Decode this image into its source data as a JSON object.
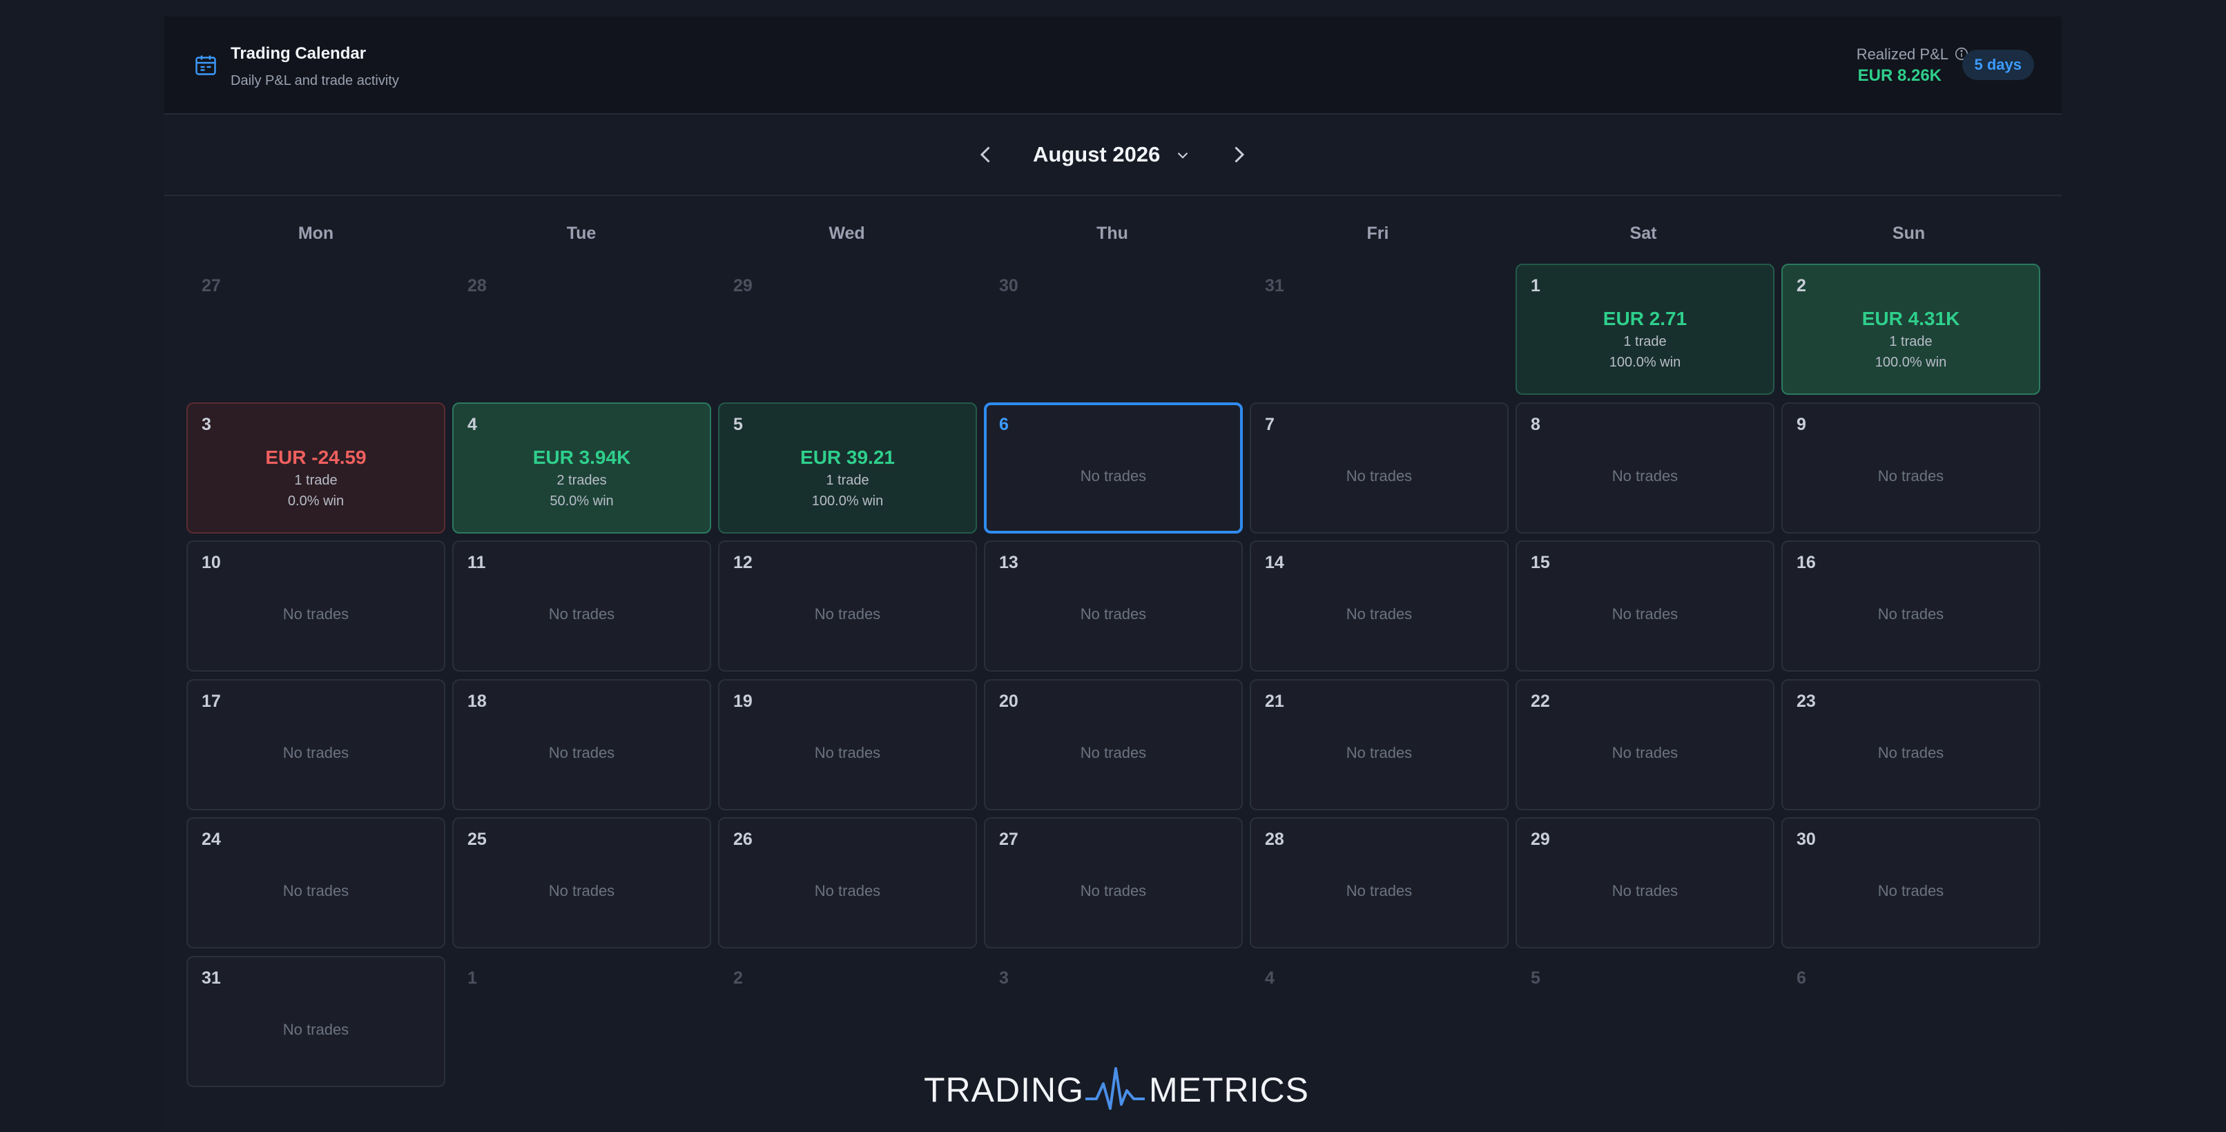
{
  "header": {
    "title": "Trading Calendar",
    "subtitle": "Daily P&L and trade activity",
    "pnl_label": "Realized P&L",
    "pnl_value": "EUR 8.26K",
    "days_badge": "5 days"
  },
  "month_nav": {
    "label": "August 2026"
  },
  "weekdays": [
    "Mon",
    "Tue",
    "Wed",
    "Thu",
    "Fri",
    "Sat",
    "Sun"
  ],
  "no_trades_text": "No trades",
  "weeks": [
    [
      {
        "day": "27",
        "state": "outside"
      },
      {
        "day": "28",
        "state": "outside"
      },
      {
        "day": "29",
        "state": "outside"
      },
      {
        "day": "30",
        "state": "outside"
      },
      {
        "day": "31",
        "state": "outside"
      },
      {
        "day": "1",
        "state": "gain",
        "amount": "EUR 2.71",
        "trades": "1 trade",
        "win": "100.0% win"
      },
      {
        "day": "2",
        "state": "gain-strong",
        "amount": "EUR 4.31K",
        "trades": "1 trade",
        "win": "100.0% win"
      }
    ],
    [
      {
        "day": "3",
        "state": "loss",
        "amount": "EUR -24.59",
        "trades": "1 trade",
        "win": "0.0% win"
      },
      {
        "day": "4",
        "state": "gain-strong",
        "amount": "EUR 3.94K",
        "trades": "2 trades",
        "win": "50.0% win"
      },
      {
        "day": "5",
        "state": "gain",
        "amount": "EUR 39.21",
        "trades": "1 trade",
        "win": "100.0% win"
      },
      {
        "day": "6",
        "state": "today"
      },
      {
        "day": "7",
        "state": "empty"
      },
      {
        "day": "8",
        "state": "empty"
      },
      {
        "day": "9",
        "state": "empty"
      }
    ],
    [
      {
        "day": "10",
        "state": "empty"
      },
      {
        "day": "11",
        "state": "empty"
      },
      {
        "day": "12",
        "state": "empty"
      },
      {
        "day": "13",
        "state": "empty"
      },
      {
        "day": "14",
        "state": "empty"
      },
      {
        "day": "15",
        "state": "empty"
      },
      {
        "day": "16",
        "state": "empty"
      }
    ],
    [
      {
        "day": "17",
        "state": "empty"
      },
      {
        "day": "18",
        "state": "empty"
      },
      {
        "day": "19",
        "state": "empty"
      },
      {
        "day": "20",
        "state": "empty"
      },
      {
        "day": "21",
        "state": "empty"
      },
      {
        "day": "22",
        "state": "empty"
      },
      {
        "day": "23",
        "state": "empty"
      }
    ],
    [
      {
        "day": "24",
        "state": "empty"
      },
      {
        "day": "25",
        "state": "empty"
      },
      {
        "day": "26",
        "state": "empty"
      },
      {
        "day": "27",
        "state": "empty"
      },
      {
        "day": "28",
        "state": "empty"
      },
      {
        "day": "29",
        "state": "empty"
      },
      {
        "day": "30",
        "state": "empty"
      }
    ],
    [
      {
        "day": "31",
        "state": "empty"
      },
      {
        "day": "1",
        "state": "outside"
      },
      {
        "day": "2",
        "state": "outside"
      },
      {
        "day": "3",
        "state": "outside"
      },
      {
        "day": "4",
        "state": "outside"
      },
      {
        "day": "5",
        "state": "outside"
      },
      {
        "day": "6",
        "state": "outside"
      }
    ]
  ],
  "logo": {
    "left": "TRADING",
    "right": "METRICS"
  },
  "colors": {
    "gain": "#2fcf8c",
    "loss": "#f0605e",
    "accent": "#2f8cf0"
  }
}
